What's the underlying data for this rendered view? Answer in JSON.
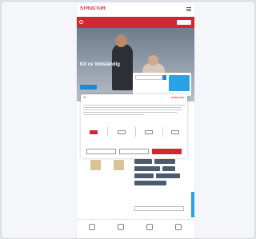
{
  "page": {
    "background": "#dfe4eb"
  },
  "site": {
    "logo_text": "STRUCTURE",
    "brand_color": "#d22630",
    "accent_color": "#1c8ad4"
  },
  "alert": {
    "text": "",
    "button_label": ""
  },
  "hero": {
    "headline": "Kit vs Vollständig"
  },
  "search": {
    "placeholder": "",
    "tip": ""
  },
  "cookie_modal": {
    "close_icon": "close-icon",
    "heading": "",
    "options": [
      {
        "label": "",
        "enabled": true
      },
      {
        "label": "",
        "enabled": false
      },
      {
        "label": "",
        "enabled": false
      },
      {
        "label": "",
        "enabled": false
      }
    ],
    "link_text": "",
    "buttons": [
      {
        "label": ""
      },
      {
        "label": ""
      },
      {
        "label": ""
      }
    ]
  },
  "below": {
    "label": "",
    "sub_label": "",
    "select_value": ""
  },
  "bottom_nav": [
    {
      "icon": "home-icon",
      "label": ""
    },
    {
      "icon": "store-icon",
      "label": ""
    },
    {
      "icon": "user-icon",
      "label": ""
    },
    {
      "icon": "cart-icon",
      "label": ""
    }
  ]
}
